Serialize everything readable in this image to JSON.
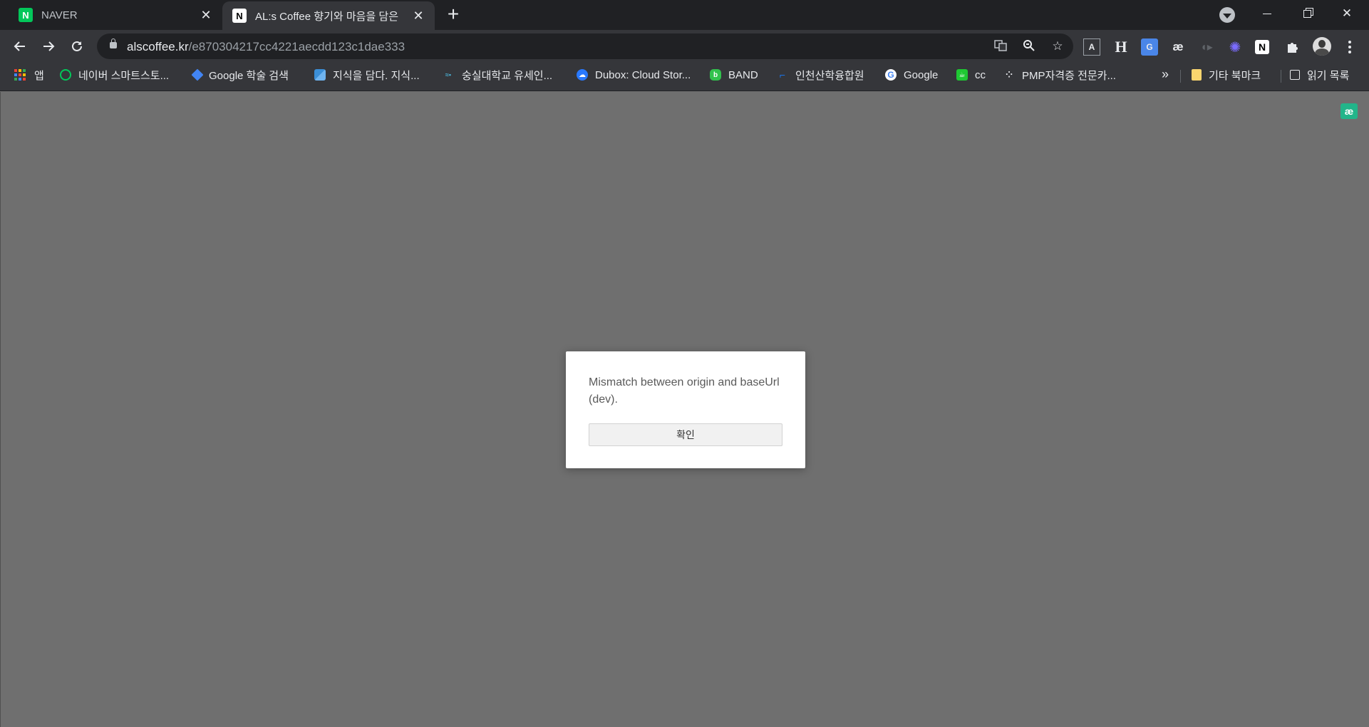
{
  "tabs": [
    {
      "title": "NAVER",
      "favicon": "N"
    },
    {
      "title": "AL:s Coffee 향기와 마음을 담은",
      "favicon": "N"
    }
  ],
  "address_bar": {
    "host": "alscoffee.kr",
    "path": "/e870304217cc4221aecdd123c1dae333"
  },
  "extensions": [
    "translate-icon",
    "zoom-icon",
    "bookmark-star-icon",
    "reader-extension-icon",
    "heading-extension-icon",
    "google-translate-icon",
    "ae-extension-icon",
    "audio-extension-icon",
    "flower-extension-icon",
    "notion-extension-icon",
    "puzzle-icon"
  ],
  "bookmarks": [
    {
      "label": "앱",
      "icon": "apps-grid-icon"
    },
    {
      "label": "네이버 스마트스토...",
      "icon": "naver-smartstore-icon",
      "color": "#03c75a"
    },
    {
      "label": "Google 학술 검색",
      "icon": "google-scholar-icon",
      "color": "#4285f4"
    },
    {
      "label": "지식을 담다. 지식...",
      "icon": "knowledge-icon",
      "color": "#3b8fd8"
    },
    {
      "label": "숭실대학교 유세인...",
      "icon": "soongsil-icon",
      "color": "#4ab3d6"
    },
    {
      "label": "Dubox: Cloud Stor...",
      "icon": "dubox-icon",
      "color": "#2979ff"
    },
    {
      "label": "BAND",
      "icon": "band-icon",
      "color": "#32c24d"
    },
    {
      "label": "인천산학융합원",
      "icon": "incheon-icon",
      "color": "#1a73e8"
    },
    {
      "label": "Google",
      "icon": "google-icon",
      "color": "#ffffff"
    },
    {
      "label": "cc",
      "icon": "cc-icon",
      "color": "#1ec832"
    },
    {
      "label": "PMP자격증 전문카...",
      "icon": "pmp-icon",
      "color": "#000000"
    }
  ],
  "bookmarks_more": "»",
  "bookmarks_right": [
    {
      "label": "기타 북마크",
      "icon": "folder-icon",
      "color": "#f9d56e"
    },
    {
      "label": "읽기 목록",
      "icon": "reading-list-icon"
    }
  ],
  "page": {
    "badge": "æ"
  },
  "dialog": {
    "message": "Mismatch between origin and baseUrl (dev).",
    "confirm_label": "확인"
  }
}
